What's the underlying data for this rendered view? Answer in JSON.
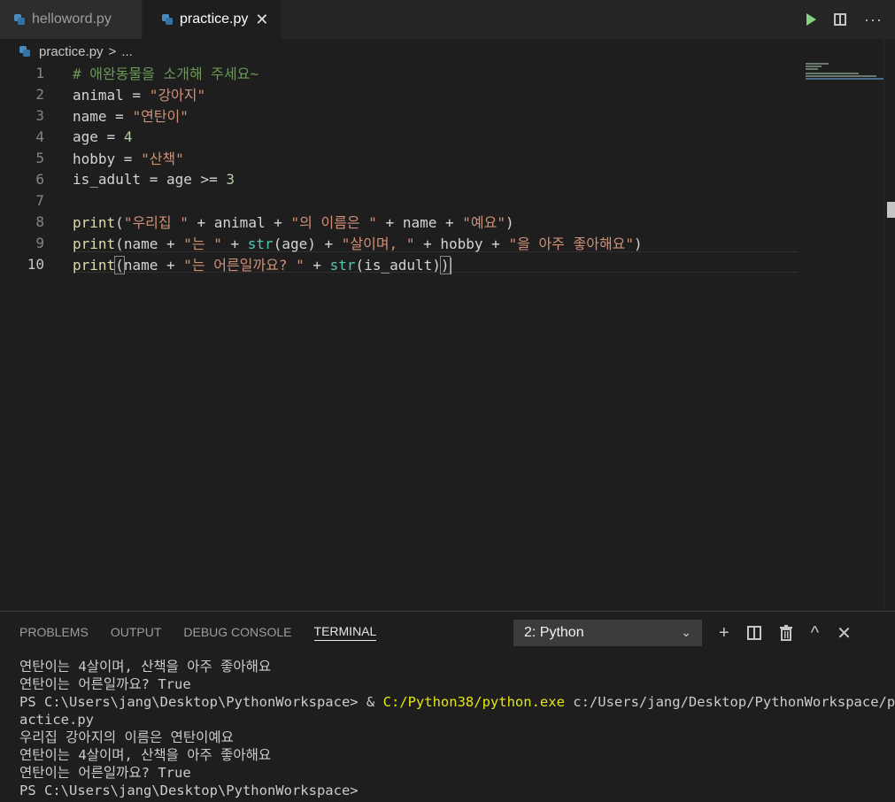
{
  "tabs": [
    {
      "label": "helloword.py",
      "active": false
    },
    {
      "label": "practice.py",
      "active": true
    }
  ],
  "tab_close_glyph": "✕",
  "actions": {
    "run": "run-icon",
    "split": "split-editor-icon",
    "more": "···"
  },
  "breadcrumb": {
    "file": "practice.py",
    "separator": ">",
    "rest": "..."
  },
  "editor": {
    "line_numbers": [
      "1",
      "2",
      "3",
      "4",
      "5",
      "6",
      "7",
      "8",
      "9",
      "10"
    ],
    "lines": [
      [
        {
          "t": "comment",
          "v": "# 애완동물을 소개해 주세요~"
        }
      ],
      [
        {
          "t": "var",
          "v": "animal"
        },
        {
          "t": "op",
          "v": " = "
        },
        {
          "t": "str",
          "v": "\"강아지\""
        }
      ],
      [
        {
          "t": "var",
          "v": "name"
        },
        {
          "t": "op",
          "v": " = "
        },
        {
          "t": "str",
          "v": "\"연탄이\""
        }
      ],
      [
        {
          "t": "var",
          "v": "age"
        },
        {
          "t": "op",
          "v": " = "
        },
        {
          "t": "num",
          "v": "4"
        }
      ],
      [
        {
          "t": "var",
          "v": "hobby"
        },
        {
          "t": "op",
          "v": " = "
        },
        {
          "t": "str",
          "v": "\"산책\""
        }
      ],
      [
        {
          "t": "var",
          "v": "is_adult"
        },
        {
          "t": "op",
          "v": " = "
        },
        {
          "t": "var",
          "v": "age"
        },
        {
          "t": "op",
          "v": " >= "
        },
        {
          "t": "num",
          "v": "3"
        }
      ],
      [],
      [
        {
          "t": "fn",
          "v": "print"
        },
        {
          "t": "op",
          "v": "("
        },
        {
          "t": "str",
          "v": "\"우리집 \""
        },
        {
          "t": "op",
          "v": " + "
        },
        {
          "t": "var",
          "v": "animal"
        },
        {
          "t": "op",
          "v": " + "
        },
        {
          "t": "str",
          "v": "\"의 이름은 \""
        },
        {
          "t": "op",
          "v": " + "
        },
        {
          "t": "var",
          "v": "name"
        },
        {
          "t": "op",
          "v": " + "
        },
        {
          "t": "str",
          "v": "\"예요\""
        },
        {
          "t": "op",
          "v": ")"
        }
      ],
      [
        {
          "t": "fn",
          "v": "print"
        },
        {
          "t": "op",
          "v": "("
        },
        {
          "t": "var",
          "v": "name"
        },
        {
          "t": "op",
          "v": " + "
        },
        {
          "t": "str",
          "v": "\"는 \""
        },
        {
          "t": "op",
          "v": " + "
        },
        {
          "t": "builtin",
          "v": "str"
        },
        {
          "t": "op",
          "v": "("
        },
        {
          "t": "var",
          "v": "age"
        },
        {
          "t": "op",
          "v": ") + "
        },
        {
          "t": "str",
          "v": "\"살이며, \""
        },
        {
          "t": "op",
          "v": " + "
        },
        {
          "t": "var",
          "v": "hobby"
        },
        {
          "t": "op",
          "v": " + "
        },
        {
          "t": "str",
          "v": "\"을 아주 좋아해요\""
        },
        {
          "t": "op",
          "v": ")"
        }
      ],
      [
        {
          "t": "fn",
          "v": "print"
        },
        {
          "t": "bracket",
          "v": "("
        },
        {
          "t": "var",
          "v": "name"
        },
        {
          "t": "op",
          "v": " + "
        },
        {
          "t": "str",
          "v": "\"는 어른일까요? \""
        },
        {
          "t": "op",
          "v": " + "
        },
        {
          "t": "builtin",
          "v": "str"
        },
        {
          "t": "op",
          "v": "("
        },
        {
          "t": "var",
          "v": "is_adult"
        },
        {
          "t": "op",
          "v": ")"
        },
        {
          "t": "bracket",
          "v": ")"
        }
      ]
    ],
    "current_line": 10
  },
  "panel": {
    "tabs": [
      {
        "label": "PROBLEMS",
        "active": false
      },
      {
        "label": "OUTPUT",
        "active": false
      },
      {
        "label": "DEBUG CONSOLE",
        "active": false
      },
      {
        "label": "TERMINAL",
        "active": true
      }
    ],
    "terminal_select": "2: Python",
    "actions": {
      "add": "+",
      "kill": "trash-icon",
      "maximize": "^",
      "close": "✕"
    },
    "terminal_lines": [
      [
        {
          "c": "",
          "v": "연탄이는 4살이며, 산책을 아주 좋아해요"
        }
      ],
      [
        {
          "c": "",
          "v": "연탄이는 어른일까요? True"
        }
      ],
      [
        {
          "c": "",
          "v": "PS C:\\Users\\jang\\Desktop\\PythonWorkspace> & "
        },
        {
          "c": "yellow",
          "v": "C:/Python38/python.exe"
        },
        {
          "c": "",
          "v": " c:/Users/jang/Desktop/PythonWorkspace/pr"
        }
      ],
      [
        {
          "c": "",
          "v": "actice.py"
        }
      ],
      [
        {
          "c": "",
          "v": "우리집 강아지의 이름은 연탄이예요"
        }
      ],
      [
        {
          "c": "",
          "v": "연탄이는 4살이며, 산책을 아주 좋아해요"
        }
      ],
      [
        {
          "c": "",
          "v": "연탄이는 어른일까요? True"
        }
      ],
      [
        {
          "c": "",
          "v": "PS C:\\Users\\jang\\Desktop\\PythonWorkspace>"
        }
      ]
    ]
  },
  "colors": {
    "comment": "#6a9955",
    "string": "#ce9178",
    "number": "#b5cea8",
    "function": "#dcdcaa",
    "builtin": "#4ec9b0",
    "run_green": "#89d185"
  }
}
